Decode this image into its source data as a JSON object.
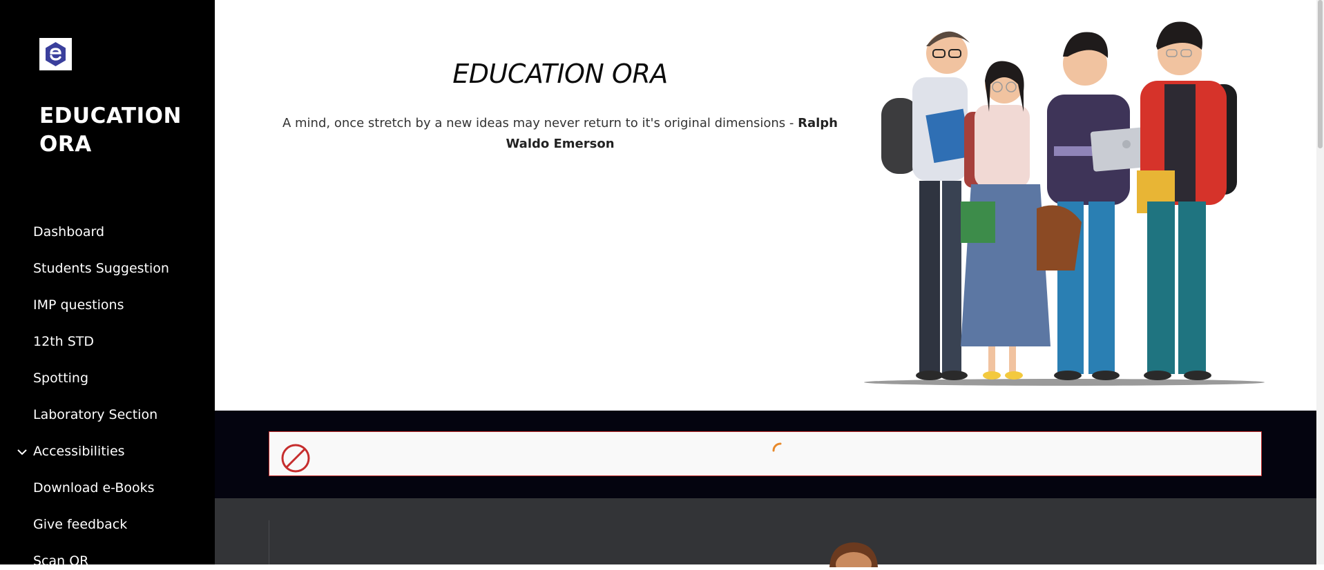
{
  "sidebar": {
    "brand": "EDUCATION ORA",
    "logo_icon": "education-ora-logo",
    "items": [
      {
        "label": "Dashboard"
      },
      {
        "label": "Students Suggestion"
      },
      {
        "label": "IMP questions"
      },
      {
        "label": "12th STD"
      },
      {
        "label": "Spotting"
      },
      {
        "label": "Laboratory Section"
      },
      {
        "label": "Accessibilities",
        "icon": "chevron-down-icon"
      },
      {
        "label": "Download e-Books"
      },
      {
        "label": "Give feedback"
      },
      {
        "label": "Scan QR"
      }
    ]
  },
  "hero": {
    "title": "EDUCATION ORA",
    "quote": "A mind, once stretch by a new ideas may never return to it's original dimensions - ",
    "author": "Ralph Waldo Emerson",
    "illustration": "students-group-illustration"
  },
  "embed": {
    "status_icon": "blocked-icon",
    "loading_icon": "spinner-icon"
  },
  "colors": {
    "sidebar_bg": "#000000",
    "band_bg": "#04040f",
    "lower_bg": "#333437",
    "embed_border": "#c62d2d",
    "spinner": "#e8892a",
    "logo_blue": "#3a3f9c"
  }
}
